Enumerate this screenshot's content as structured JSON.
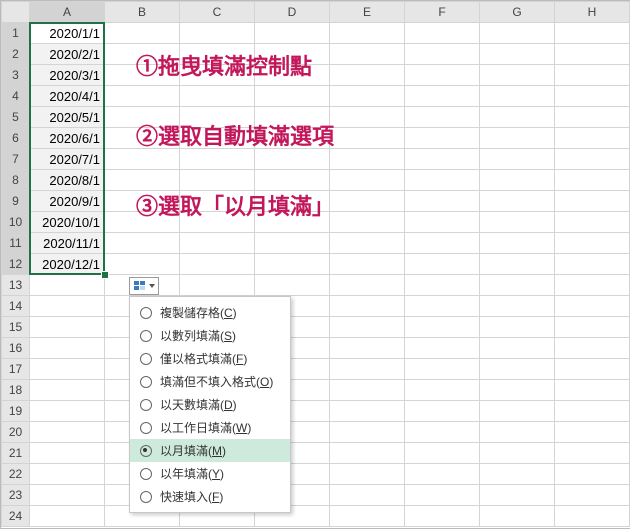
{
  "columns": [
    "A",
    "B",
    "C",
    "D",
    "E",
    "F",
    "G",
    "H"
  ],
  "rows": [
    "1",
    "2",
    "3",
    "4",
    "5",
    "6",
    "7",
    "8",
    "9",
    "10",
    "11",
    "12",
    "13",
    "14",
    "15",
    "16",
    "17",
    "18",
    "19",
    "20",
    "21",
    "22",
    "23",
    "24"
  ],
  "values": [
    "2020/1/1",
    "2020/2/1",
    "2020/3/1",
    "2020/4/1",
    "2020/5/1",
    "2020/6/1",
    "2020/7/1",
    "2020/8/1",
    "2020/9/1",
    "2020/10/1",
    "2020/11/1",
    "2020/12/1"
  ],
  "annotations": {
    "a1": "①拖曳填滿控制點",
    "a2": "②選取自動填滿選項",
    "a3": "③選取「以月填滿」"
  },
  "menu": {
    "items": [
      {
        "label": "複製儲存格",
        "key": "C"
      },
      {
        "label": "以數列填滿",
        "key": "S"
      },
      {
        "label": "僅以格式填滿",
        "key": "F"
      },
      {
        "label": "填滿但不填入格式",
        "key": "O"
      },
      {
        "label": "以天數填滿",
        "key": "D"
      },
      {
        "label": "以工作日填滿",
        "key": "W"
      },
      {
        "label": "以月填滿",
        "key": "M"
      },
      {
        "label": "以年填滿",
        "key": "Y"
      },
      {
        "label": "快速填入",
        "key": "F"
      }
    ],
    "selectedIndex": 6
  }
}
